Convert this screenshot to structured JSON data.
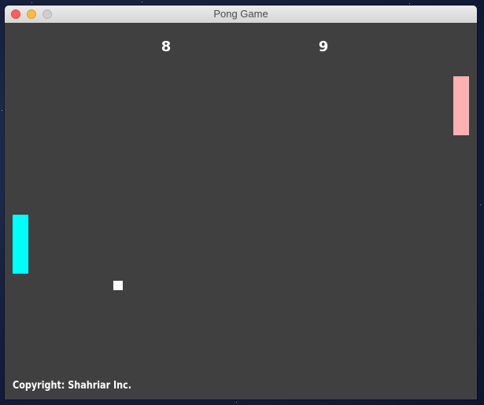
{
  "window": {
    "title": "Pong Game"
  },
  "game": {
    "score_left": "8",
    "score_right": "9",
    "copyright": "Copyright: Shahriar Inc.",
    "colors": {
      "background": "#404040",
      "left_paddle": "#00ffff",
      "right_paddle": "#ffb0b0",
      "ball": "#ffffff"
    }
  }
}
